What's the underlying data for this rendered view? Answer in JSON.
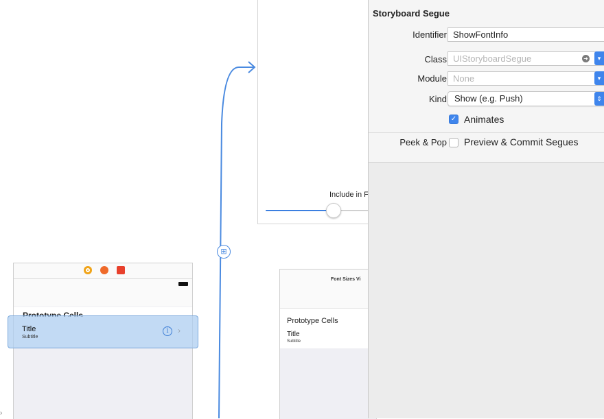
{
  "canvas": {
    "top_scene": {
      "slider_label": "Include in F"
    },
    "left_scene": {
      "section_header": "Prototype Cells",
      "cell": {
        "title": "Title",
        "subtitle": "Subtitle",
        "info_glyph": "i",
        "chevron_glyph": "›"
      },
      "dock_icons": [
        "view-controller-icon",
        "first-responder-icon",
        "exit-icon"
      ]
    },
    "mid_scene": {
      "nav_title": "Font Sizes Vi",
      "section_header": "Prototype Cells",
      "cell_title": "Title",
      "cell_subtitle": "Subtitle"
    },
    "segue_badge_glyph": "⊞",
    "edge_mark": "›"
  },
  "inspector": {
    "section_title": "Storyboard Segue",
    "identifier": {
      "label": "Identifier",
      "value": "ShowFontInfo"
    },
    "class": {
      "label": "Class",
      "placeholder": "UIStoryboardSegue"
    },
    "module": {
      "label": "Module",
      "placeholder": "None"
    },
    "kind": {
      "label": "Kind",
      "value": "Show (e.g. Push)"
    },
    "animates": {
      "label": "Animates",
      "checked": true
    },
    "peek_pop": {
      "label": "Peek & Pop",
      "option_label": "Preview & Commit Segues",
      "checked": false
    }
  },
  "colors": {
    "accent": "#3f85ec",
    "segue_line": "#4a8ae0",
    "selection": "#adcdf0"
  }
}
